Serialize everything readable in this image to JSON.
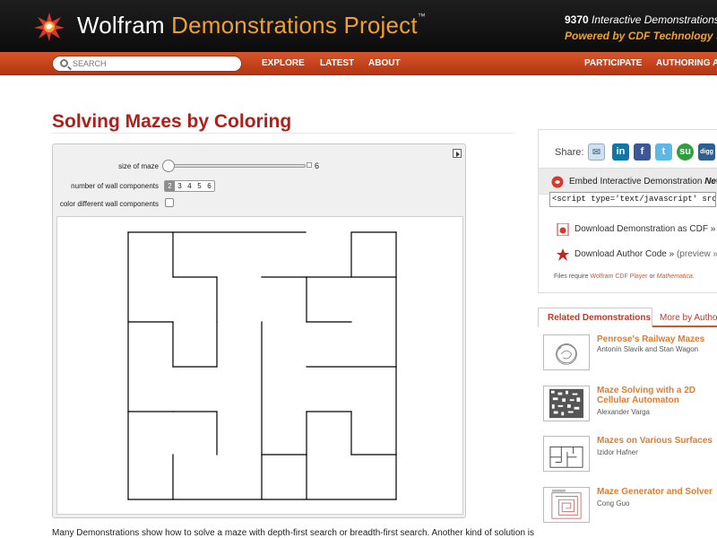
{
  "header": {
    "title_part1": "Wolfram",
    "title_part2": "Demonstrations Project",
    "tm": "™",
    "count": "9370",
    "count_suffix": "Interactive Demonstrations",
    "powered_by": "Powered by CDF Technology »"
  },
  "nav": {
    "search_placeholder": "SEARCH",
    "links": [
      "EXPLORE",
      "LATEST",
      "ABOUT",
      "PARTICIPATE",
      "AUTHORING AREA"
    ]
  },
  "page": {
    "title": "Solving Mazes by Coloring",
    "description": "Many Demonstrations show how to solve a maze with depth-first search or breadth-first search. Another kind of solution is"
  },
  "demo": {
    "controls": {
      "size_label": "size of maze",
      "size_value": "6",
      "size_fraction": 0.0,
      "wall_label": "number of wall components",
      "wall_options": [
        "2",
        "3",
        "4",
        "5",
        "6"
      ],
      "wall_selected": "2",
      "color_label": "color different wall components",
      "color_checked": false
    }
  },
  "sidebar": {
    "share_label": "Share:",
    "share_icons": [
      "email-icon",
      "linkedin-icon",
      "facebook-icon",
      "twitter-icon",
      "stumbleupon-icon",
      "digg-icon"
    ],
    "share_glyphs": [
      "✉",
      "in",
      "f",
      "t",
      "su",
      "digg"
    ],
    "embed_label": "Embed Interactive Demonstration",
    "embed_new": "New!",
    "embed_code": "<script type='text/javascript' src='http://",
    "download_cdf": "Download Demonstration as CDF »",
    "download_code": "Download Author Code »",
    "preview": "(preview »)",
    "req_prefix": "Files require",
    "req_player": "Wolfram CDF Player",
    "req_or": "or",
    "req_math": "Mathematica.",
    "tabs": [
      "Related Demonstrations",
      "More by Author"
    ],
    "related": [
      {
        "title": "Penrose's Railway Mazes",
        "author": "Antonín Slavík and Stan Wagon"
      },
      {
        "title": "Maze Solving with a 2D Cellular Automaton",
        "author": "Alexander Varga"
      },
      {
        "title": "Mazes on Various Surfaces",
        "author": "Izidor Hafner"
      },
      {
        "title": "Maze Generator and Solver",
        "author": "Cong Guo"
      }
    ]
  },
  "colors": {
    "title_red": "#b0201a",
    "nav_orange": "#c8401c",
    "accent_orange": "#f0a030",
    "related_orange": "#e37b32"
  }
}
